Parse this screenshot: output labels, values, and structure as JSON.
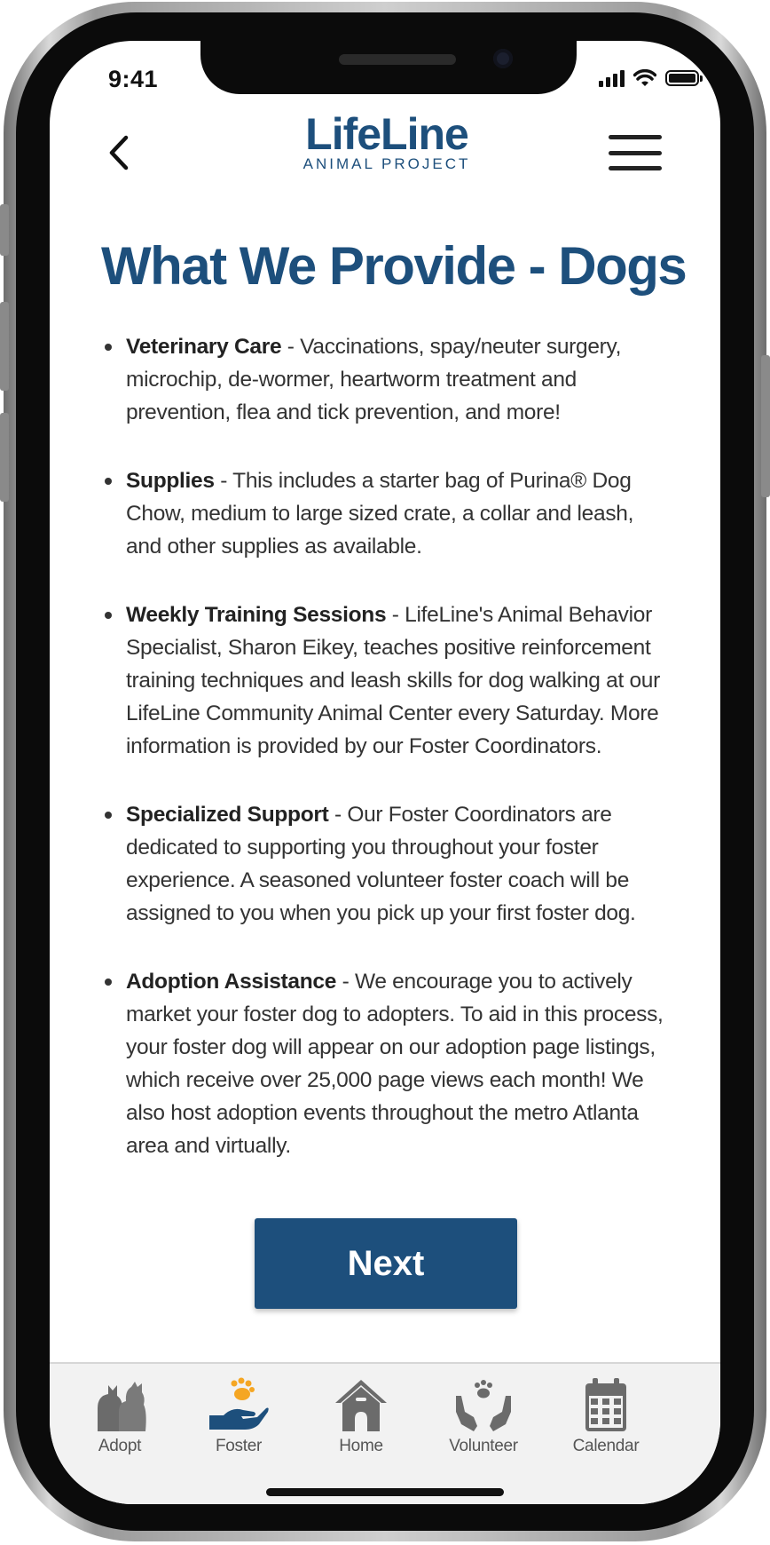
{
  "status_bar": {
    "time": "9:41"
  },
  "header": {
    "logo_main": "LifeLine",
    "logo_sub": "ANIMAL PROJECT"
  },
  "page": {
    "title": "What We Provide - Dogs",
    "items": [
      {
        "title": "Veterinary Care",
        "text": " - Vaccinations, spay/neuter surgery, microchip, de-wormer, heartworm treatment and prevention, flea and tick prevention, and more!"
      },
      {
        "title": "Supplies",
        "text": " - This includes a starter bag of Purina® Dog Chow, medium to large sized crate, a collar and leash, and other supplies as available."
      },
      {
        "title": "Weekly Training Sessions",
        "text": " - LifeLine's Animal Behavior Specialist, Sharon Eikey, teaches positive reinforcement training techniques and leash skills for dog walking at our LifeLine Community Animal Center every Saturday. More information is provided by our Foster Coordinators."
      },
      {
        "title": "Specialized Support",
        "text": " - Our Foster Coordinators are dedicated to supporting you throughout your foster experience. A seasoned volunteer foster coach will be assigned to you when you pick up your first foster dog."
      },
      {
        "title": "Adoption Assistance",
        "text": " - We encourage you to actively market your foster dog to adopters. To aid in this process, your foster dog will appear on our adoption page listings, which receive over 25,000 page views each month! We also host adoption events throughout the metro Atlanta area and virtually."
      }
    ],
    "next_label": "Next"
  },
  "tabbar": {
    "tabs": [
      {
        "label": "Adopt",
        "icon": "pets-icon",
        "active": false
      },
      {
        "label": "Foster",
        "icon": "paw-hand-icon",
        "active": true
      },
      {
        "label": "Home",
        "icon": "house-icon",
        "active": false
      },
      {
        "label": "Volunteer",
        "icon": "helping-hands-icon",
        "active": false
      },
      {
        "label": "Calendar",
        "icon": "calendar-icon",
        "active": false
      }
    ]
  },
  "colors": {
    "brand_blue": "#1d4f7c",
    "foster_orange": "#f5a623",
    "tab_icon_gray": "#6b6b6b"
  }
}
